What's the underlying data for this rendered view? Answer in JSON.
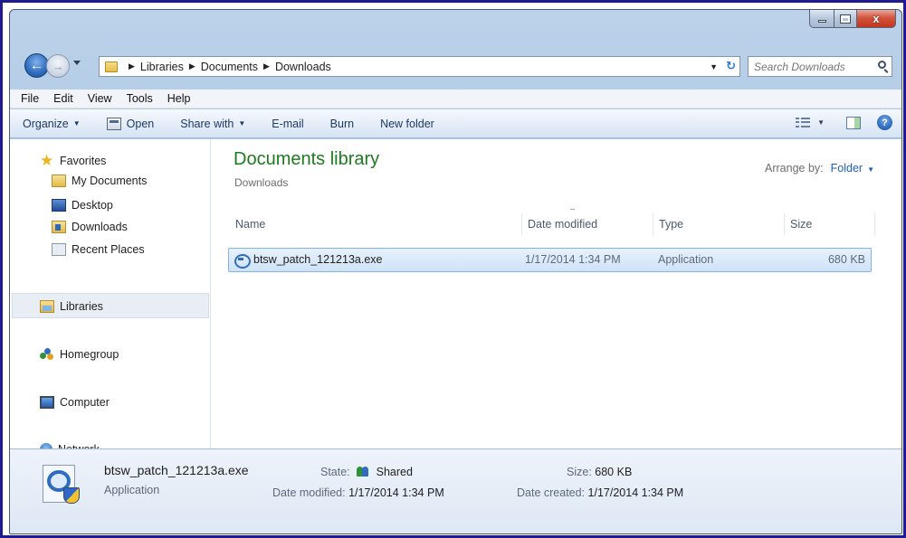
{
  "window": {
    "caption_close": "x"
  },
  "nav": {
    "breadcrumbs": [
      "Libraries",
      "Documents",
      "Downloads"
    ],
    "search_placeholder": "Search Downloads"
  },
  "menu": [
    "File",
    "Edit",
    "View",
    "Tools",
    "Help"
  ],
  "commands": {
    "organize": "Organize",
    "open": "Open",
    "share_with": "Share with",
    "email": "E-mail",
    "burn": "Burn",
    "new_folder": "New folder"
  },
  "nav_pane": {
    "favorites": "Favorites",
    "favorites_items": [
      "My Documents",
      "Desktop",
      "Downloads",
      "Recent Places"
    ],
    "libraries": "Libraries",
    "homegroup": "Homegroup",
    "computer": "Computer",
    "network": "Network"
  },
  "library": {
    "title": "Documents library",
    "subtitle": "Downloads",
    "arrange_label": "Arrange by:",
    "arrange_value": "Folder"
  },
  "columns": {
    "name": "Name",
    "date_modified": "Date modified",
    "type": "Type",
    "size": "Size"
  },
  "files": [
    {
      "name": "btsw_patch_121213a.exe",
      "date_modified": "1/17/2014 1:34 PM",
      "type": "Application",
      "size": "680 KB"
    }
  ],
  "details": {
    "name": "btsw_patch_121213a.exe",
    "type": "Application",
    "state_label": "State:",
    "state_value": "Shared",
    "size_label": "Size:",
    "size_value": "680 KB",
    "date_modified_label": "Date modified:",
    "date_modified_value": "1/17/2014 1:34 PM",
    "date_created_label": "Date created:",
    "date_created_value": "1/17/2014 1:34 PM"
  },
  "colors": {
    "library_title": "#1e7a1e",
    "link_blue": "#1e5fb4",
    "selection": "#cfe3f8"
  }
}
